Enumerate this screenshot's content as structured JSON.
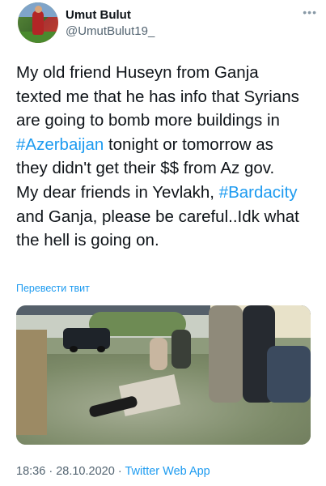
{
  "tweet": {
    "author_name": "Umut Bulut",
    "author_handle": "@UmutBulut19_",
    "more_icon": "more-horizontal-icon",
    "text_lines": [
      {
        "pre": "My old friend Huseyn from Ganja",
        "tag": "",
        "post": ""
      },
      {
        "pre": "texted me that he has info that Syrians",
        "tag": "",
        "post": ""
      },
      {
        "pre": "are going to bomb more buildings in",
        "tag": "",
        "post": ""
      },
      {
        "pre": "",
        "tag": "#Azerbaijan",
        "post": " tonight or tomorrow as"
      },
      {
        "pre": "they didn't get their $$ from Az gov.",
        "tag": "",
        "post": ""
      },
      {
        "pre": "My dear friends in Yevlakh, ",
        "tag": "#Bardacity",
        "post": ""
      },
      {
        "pre": "and Ganja, please be careful..Idk what",
        "tag": "",
        "post": ""
      },
      {
        "pre": "the hell is going on.",
        "tag": "",
        "post": ""
      }
    ],
    "translate_label": "Перевести твит",
    "time": "18:36",
    "separator": "·",
    "date": "28.10.2020",
    "source": "Twitter Web App"
  },
  "colors": {
    "link": "#1d9bf0",
    "text": "#0f1419",
    "secondary": "#536471"
  }
}
